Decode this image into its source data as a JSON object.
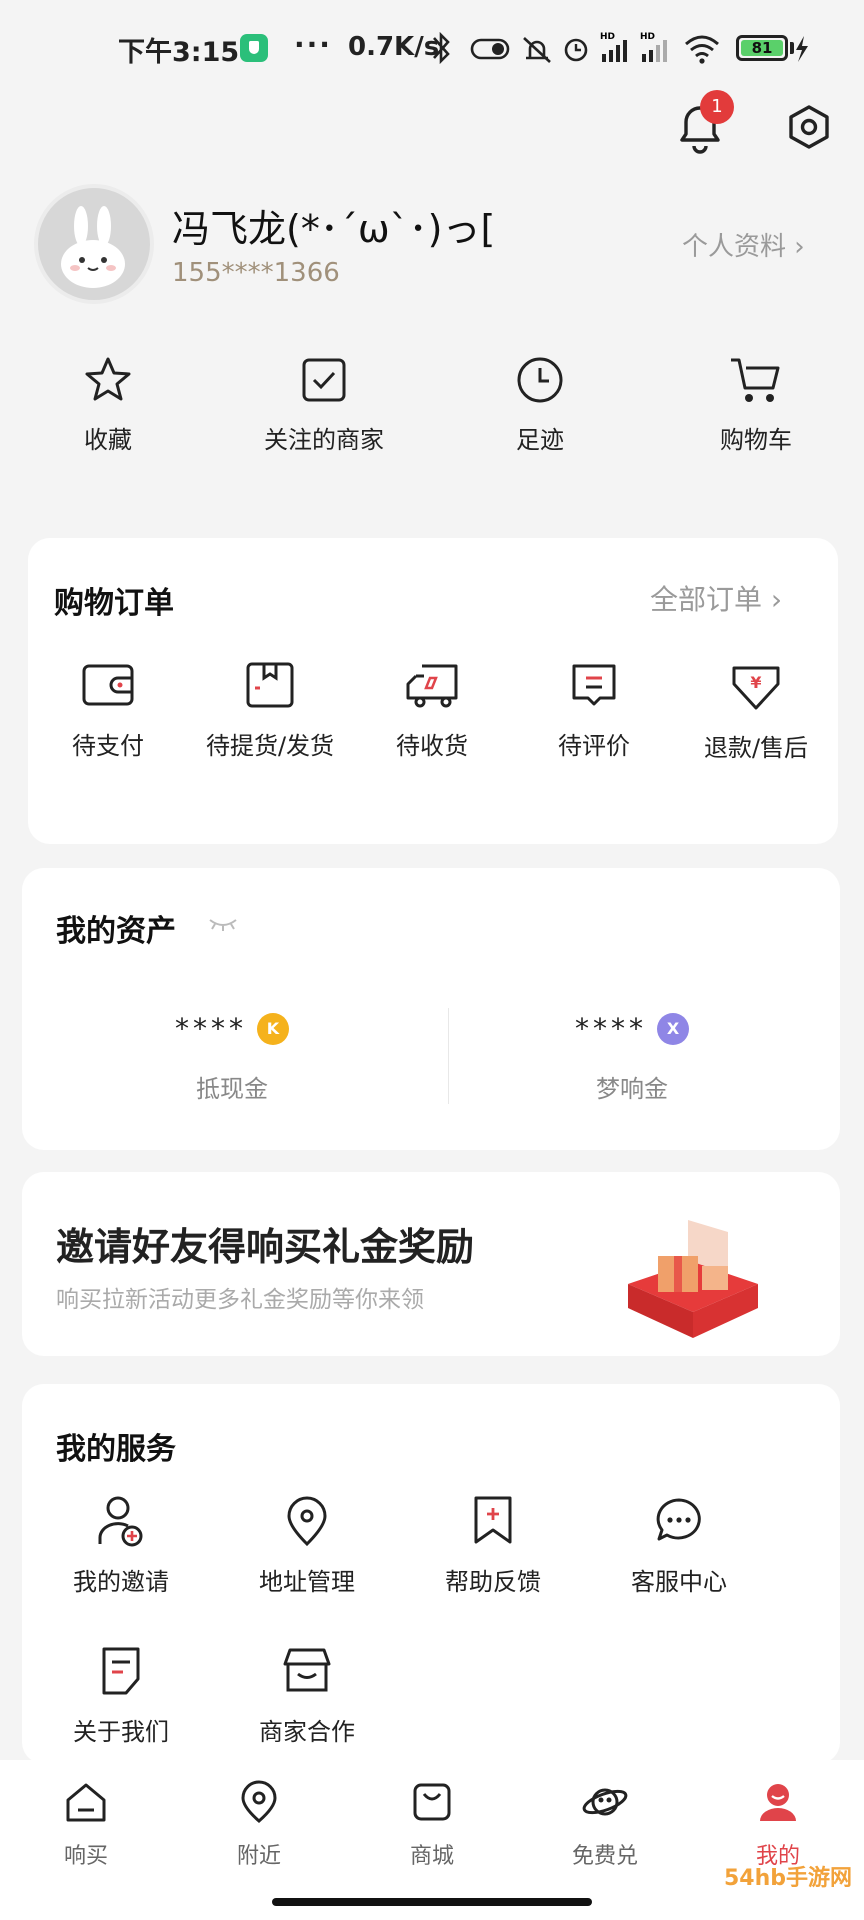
{
  "status_bar": {
    "time": "下午3:15",
    "dots": "···",
    "speed": "0.7K/s",
    "battery": "81"
  },
  "header": {
    "notification_count": "1"
  },
  "profile": {
    "username": "冯飞龙(*･´ω`･)っ[",
    "phone": "155****1366",
    "profile_link": "个人资料 ›"
  },
  "quick_actions": [
    {
      "label": "收藏",
      "icon": "star-icon"
    },
    {
      "label": "关注的商家",
      "icon": "check-square-icon"
    },
    {
      "label": "足迹",
      "icon": "clock-icon"
    },
    {
      "label": "购物车",
      "icon": "cart-icon"
    }
  ],
  "orders": {
    "title": "购物订单",
    "all_link": "全部订单 ›",
    "items": [
      {
        "label": "待支付",
        "icon": "wallet-icon"
      },
      {
        "label": "待提货/发货",
        "icon": "package-icon"
      },
      {
        "label": "待收货",
        "icon": "truck-icon"
      },
      {
        "label": "待评价",
        "icon": "comment-icon"
      },
      {
        "label": "退款/售后",
        "icon": "refund-icon"
      }
    ]
  },
  "assets": {
    "title": "我的资产",
    "items": [
      {
        "value": "****",
        "label": "抵现金",
        "coin": "K",
        "coin_color": "#f5b21c"
      },
      {
        "value": "****",
        "label": "梦响金",
        "coin": "X",
        "coin_color": "#8f86e6"
      }
    ]
  },
  "invite": {
    "title": "邀请好友得响买礼金奖励",
    "subtitle": "响买拉新活动更多礼金奖励等你来领"
  },
  "services": {
    "title": "我的服务",
    "items": [
      {
        "label": "我的邀请",
        "icon": "user-plus-icon"
      },
      {
        "label": "地址管理",
        "icon": "location-pin-icon"
      },
      {
        "label": "帮助反馈",
        "icon": "bookmark-plus-icon"
      },
      {
        "label": "客服中心",
        "icon": "chat-bubble-icon"
      },
      {
        "label": "关于我们",
        "icon": "document-icon"
      },
      {
        "label": "商家合作",
        "icon": "storefront-icon"
      }
    ]
  },
  "bottom_nav": [
    {
      "label": "响买",
      "icon": "home-icon",
      "active": false
    },
    {
      "label": "附近",
      "icon": "location-icon",
      "active": false
    },
    {
      "label": "商城",
      "icon": "shopping-bag-icon",
      "active": false
    },
    {
      "label": "免费兑",
      "icon": "planet-icon",
      "active": false
    },
    {
      "label": "我的",
      "icon": "user-icon",
      "active": true
    }
  ],
  "watermark": "54hb手游网",
  "colors": {
    "accent": "#e0444a",
    "phone_text": "#a0907a",
    "badge": "#e23b3b"
  }
}
